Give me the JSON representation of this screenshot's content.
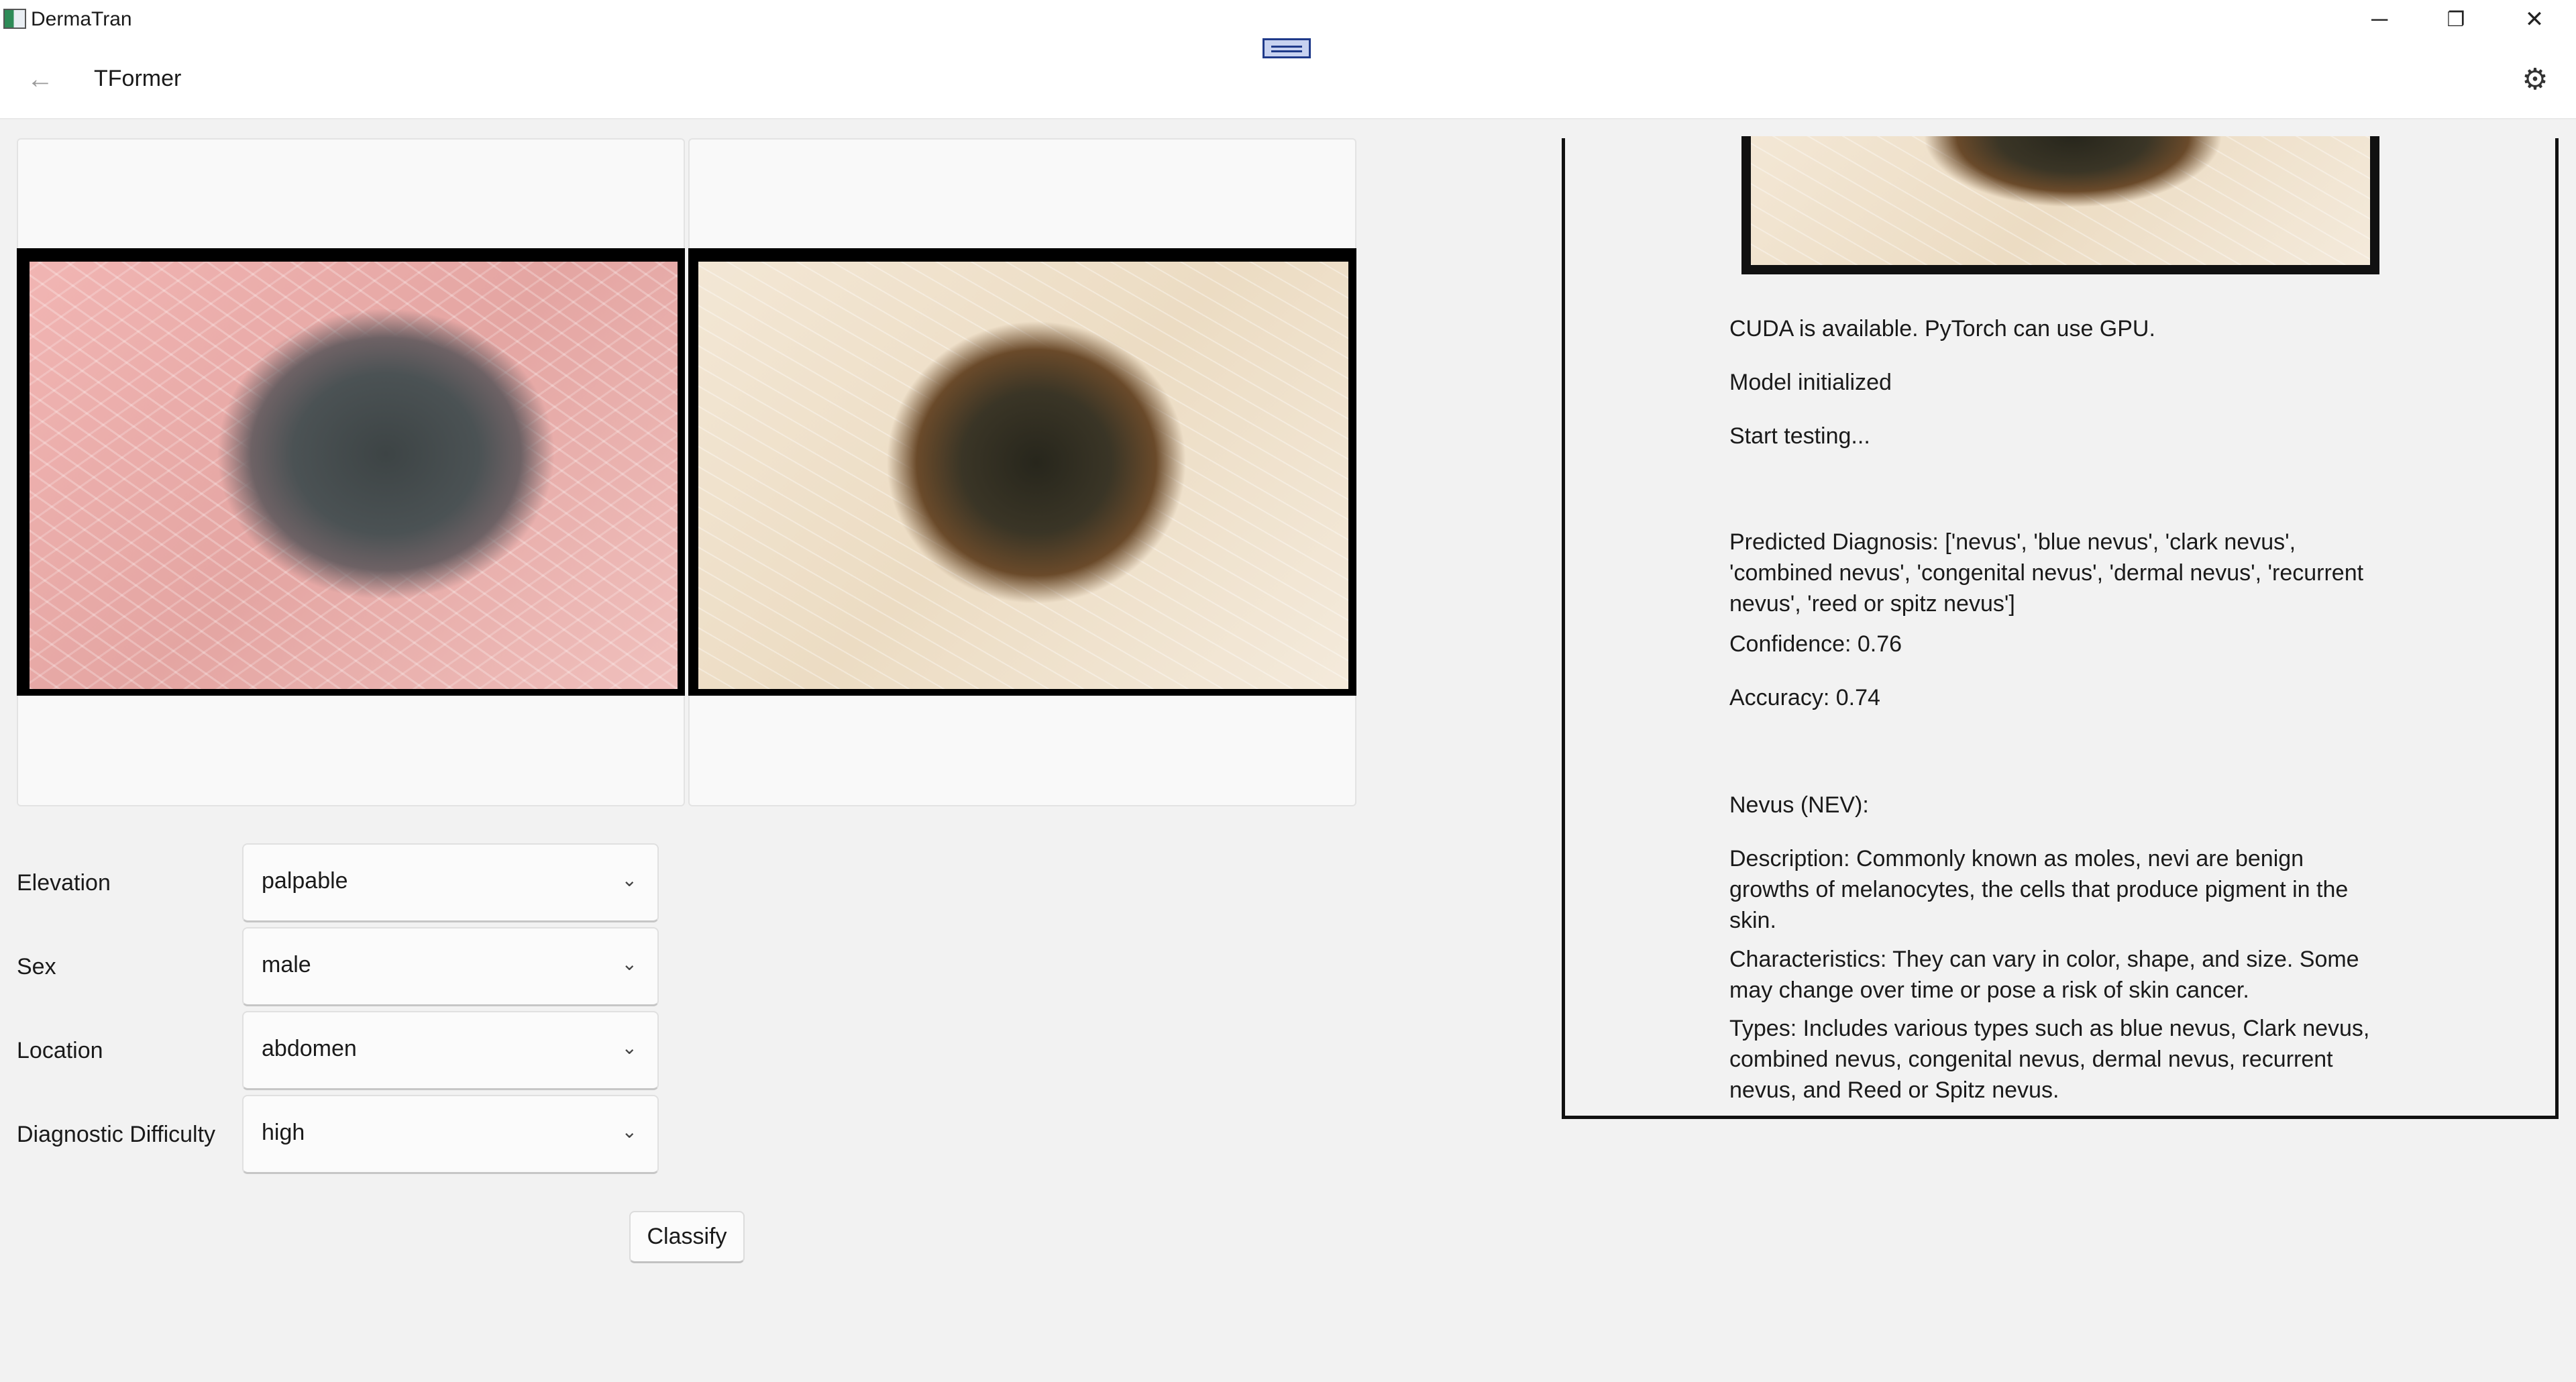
{
  "window": {
    "app_title": "DermaTran",
    "minimize_icon": "minimize-icon",
    "maximize_icon": "restore-icon",
    "close_icon": "close-icon"
  },
  "header": {
    "title": "TFormer",
    "back_icon": "back-arrow-icon",
    "settings_icon": "gear-icon"
  },
  "form": {
    "fields": [
      {
        "label": "Elevation",
        "value": "palpable"
      },
      {
        "label": "Sex",
        "value": "male"
      },
      {
        "label": "Location",
        "value": "abdomen"
      },
      {
        "label": "Diagnostic Difficulty",
        "value": "high"
      }
    ],
    "classify_label": "Classify"
  },
  "results": {
    "cuda": "CUDA is available. PyTorch can use GPU.",
    "model": "Model initialized",
    "start": "Start testing...",
    "predicted": "Predicted Diagnosis: ['nevus', 'blue nevus', 'clark nevus', 'combined nevus', 'congenital nevus', 'dermal nevus', 'recurrent nevus', 'reed or spitz nevus']",
    "confidence": "Confidence: 0.76",
    "accuracy": " Accuracy: 0.74",
    "nevus_heading": "Nevus (NEV):",
    "description": "Description: Commonly known as moles, nevi are benign growths of melanocytes, the cells that produce pigment in the skin.",
    "characteristics": "Characteristics: They can vary in color, shape, and size. Some may change over time or pose a risk of skin cancer.",
    "types": "Types: Includes various types such as blue nevus, Clark nevus, combined nevus, congenital nevus, dermal nevus, recurrent nevus, and Reed or Spitz nevus."
  }
}
